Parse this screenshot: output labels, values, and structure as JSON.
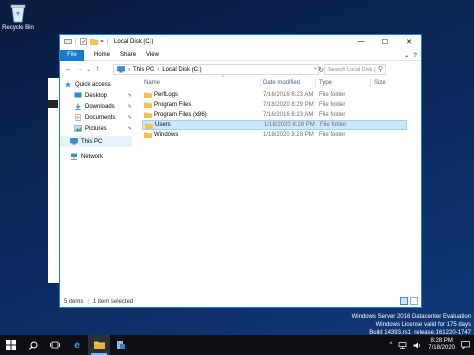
{
  "desktop": {
    "icons": [
      {
        "label": "Recycle Bin",
        "icon": "recycle-bin-icon"
      }
    ]
  },
  "window": {
    "title": "Local Disk (C:)",
    "controls": {
      "minimize": "—",
      "maximize": "☐",
      "close": "✕"
    },
    "accent": "#1979ca"
  },
  "ribbon": {
    "tabs": [
      "File",
      "Home",
      "Share",
      "View"
    ],
    "expand": "⌄",
    "help": "?"
  },
  "address": {
    "back": "←",
    "forward": "→",
    "recent": "⌄",
    "up": "↑",
    "breadcrumb": [
      "This PC",
      "Local Disk (C:)"
    ],
    "separator": "›",
    "dropdown": "⌄",
    "refresh": "↻",
    "search_placeholder": "Search Local Disk (C:)"
  },
  "nav_pane": {
    "items": [
      {
        "label": "Quick access",
        "icon": "star-icon",
        "pinned": false
      },
      {
        "label": "Desktop",
        "icon": "desktop-icon",
        "pinned": true
      },
      {
        "label": "Downloads",
        "icon": "download-icon",
        "pinned": true
      },
      {
        "label": "Documents",
        "icon": "documents-icon",
        "pinned": true
      },
      {
        "label": "Pictures",
        "icon": "pictures-icon",
        "pinned": true
      },
      {
        "label": "This PC",
        "icon": "computer-icon",
        "pinned": false,
        "selected": true
      },
      {
        "label": "Network",
        "icon": "network-icon",
        "pinned": false
      }
    ],
    "pin_glyph": "📌"
  },
  "content": {
    "columns": [
      "Name",
      "Date modified",
      "Type",
      "Size"
    ],
    "sort_glyph": "^",
    "rows": [
      {
        "name": "PerfLogs",
        "date": "7/16/2016 6:23 AM",
        "type": "File folder",
        "selected": false
      },
      {
        "name": "Program Files",
        "date": "7/18/2020 8:29 PM",
        "type": "File folder",
        "selected": false
      },
      {
        "name": "Program Files (x86)",
        "date": "7/16/2016 6:23 AM",
        "type": "File folder",
        "selected": false
      },
      {
        "name": "Users",
        "date": "1/18/2020 8:28 PM",
        "type": "File folder",
        "selected": true
      },
      {
        "name": "Windows",
        "date": "1/18/2020 8:28 PM",
        "type": "File folder",
        "selected": false
      }
    ]
  },
  "status": {
    "item_count": "5 items",
    "selection": "1 item selected"
  },
  "watermark": {
    "line1": "Windows Server 2016 Datacenter Evaluation",
    "line2": "Windows License valid for 175 days",
    "line3": "Build 14393.rs1_release.161220-1747"
  },
  "taskbar": {
    "buttons": [
      {
        "name": "start",
        "glyph": "⊞"
      },
      {
        "name": "search",
        "glyph": "⚲"
      },
      {
        "name": "task-view",
        "glyph": "▭"
      },
      {
        "name": "edge",
        "glyph": "e"
      },
      {
        "name": "file-explorer",
        "glyph": "📁",
        "active": true
      },
      {
        "name": "server-manager",
        "glyph": "🗄"
      }
    ],
    "tray": {
      "expand": "^",
      "time": "8:28 PM",
      "date": "7/18/2020",
      "notifications": "🗨"
    }
  }
}
